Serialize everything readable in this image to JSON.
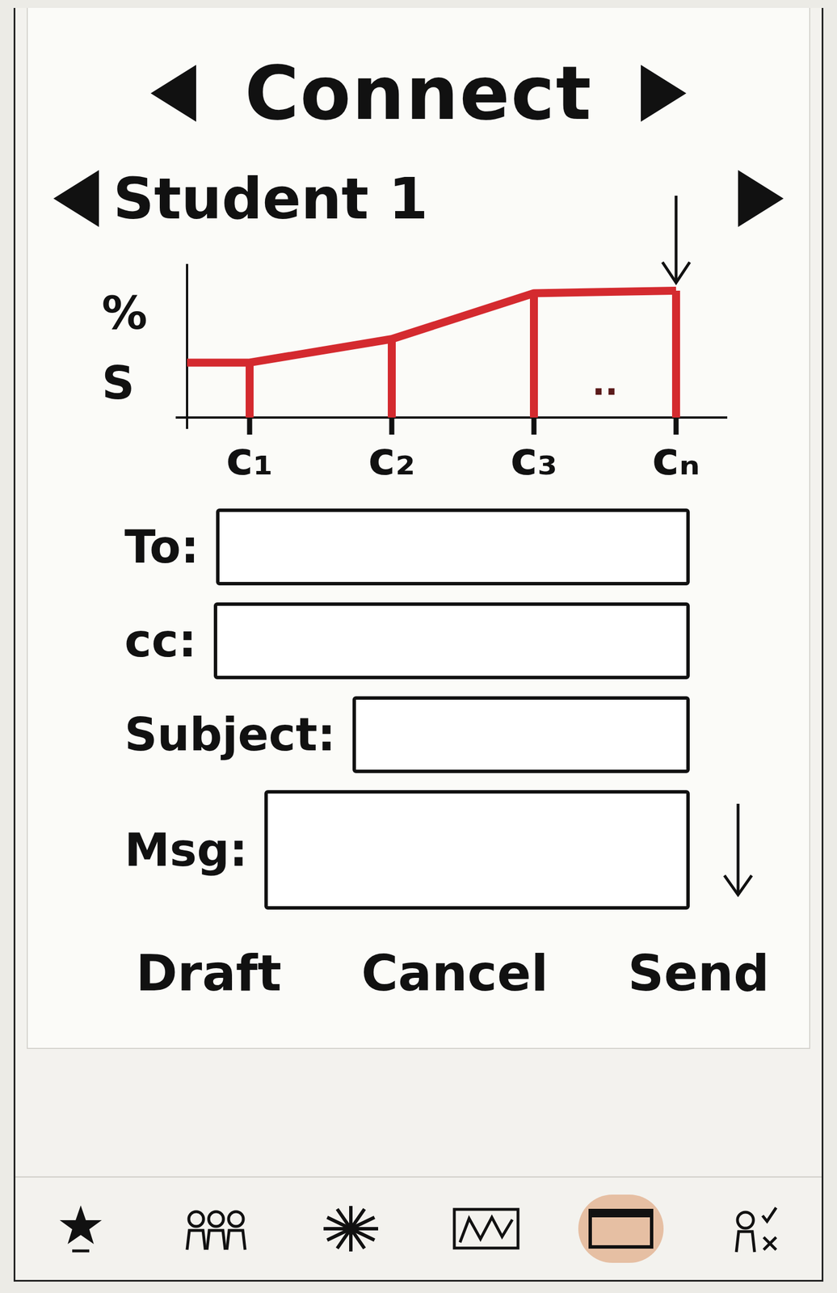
{
  "screen": {
    "title": "Connect"
  },
  "student": {
    "name": "Student 1"
  },
  "chart": {
    "y_labels": [
      "%",
      "S"
    ],
    "x_labels": [
      "c₁",
      "c₂",
      "c₃",
      "cₙ"
    ],
    "gap_mark": "..",
    "series": [
      {
        "name": "Student 1",
        "values": [
          42,
          60,
          95,
          97
        ],
        "color": "#d42a2f"
      }
    ]
  },
  "form": {
    "fields": [
      {
        "label": "To:",
        "kind": "line"
      },
      {
        "label": "cc:",
        "kind": "line"
      },
      {
        "label": "Subject:",
        "kind": "line"
      },
      {
        "label": "Msg:",
        "kind": "area"
      }
    ]
  },
  "buttons": [
    "Draft",
    "Cancel",
    "Send"
  ],
  "tab_bar": {
    "items": [
      {
        "selected": false
      },
      {
        "selected": false
      },
      {
        "selected": false
      },
      {
        "selected": false
      },
      {
        "selected": true
      },
      {
        "selected": false
      }
    ]
  }
}
